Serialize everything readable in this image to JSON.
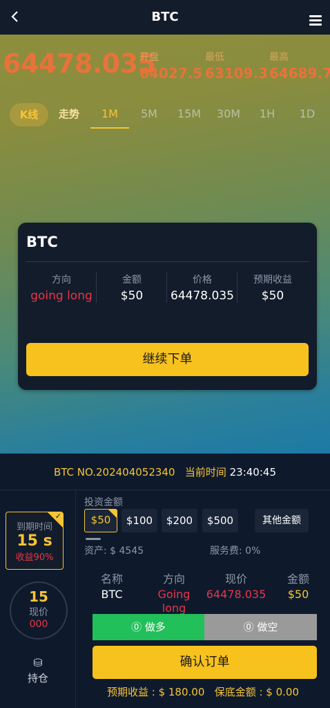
{
  "header": {
    "title": "BTC"
  },
  "ticker": {
    "price": "64478.035",
    "open_label": "开盘",
    "open": "64027.5",
    "low_label": "最低",
    "low": "63109.3",
    "high_label": "最高",
    "high": "64689.7"
  },
  "tabs": [
    "K线",
    "走势",
    "1M",
    "5M",
    "15M",
    "30M",
    "1H",
    "1D"
  ],
  "modal": {
    "title": "BTC",
    "direction_label": "方向",
    "direction": "going long",
    "amount_label": "金额",
    "amount": "$50",
    "price_label": "价格",
    "price": "64478.035",
    "expected_label": "预期收益",
    "expected": "$50",
    "continue_label": "继续下单"
  },
  "order": {
    "number": "BTC NO.202404052340",
    "time_label": "当前时间",
    "time": "23:40:45"
  },
  "expire": {
    "label": "到期时间",
    "seconds": "15 s",
    "yield": "收益90%"
  },
  "countdown": {
    "value": "15",
    "label": "现价",
    "zeros": "000"
  },
  "hold_label": "持仓",
  "invest": {
    "label": "投资金额",
    "amounts": [
      "$50",
      "$100",
      "$200",
      "$500"
    ],
    "other": "其他金额",
    "asset": "资产: $ 4545",
    "fee": "服务费:  0%"
  },
  "summary": {
    "name_label": "名称",
    "name": "BTC",
    "dir_label": "方向",
    "dir": "Going long",
    "price_label": "现价",
    "price": "64478.035",
    "amount_label": "金额",
    "amount": "$50"
  },
  "buttons": {
    "long": "做多",
    "short": "做空",
    "confirm": "确认订单"
  },
  "footer": {
    "expected": "预期收益 : $ 180.00",
    "margin": "保底金额 : $ 0.00"
  },
  "colors": {
    "accent": "#f7c21e",
    "long": "#21c05a",
    "short": "#9a9a9a",
    "down": "#e8364a",
    "price": "#e9723b"
  }
}
